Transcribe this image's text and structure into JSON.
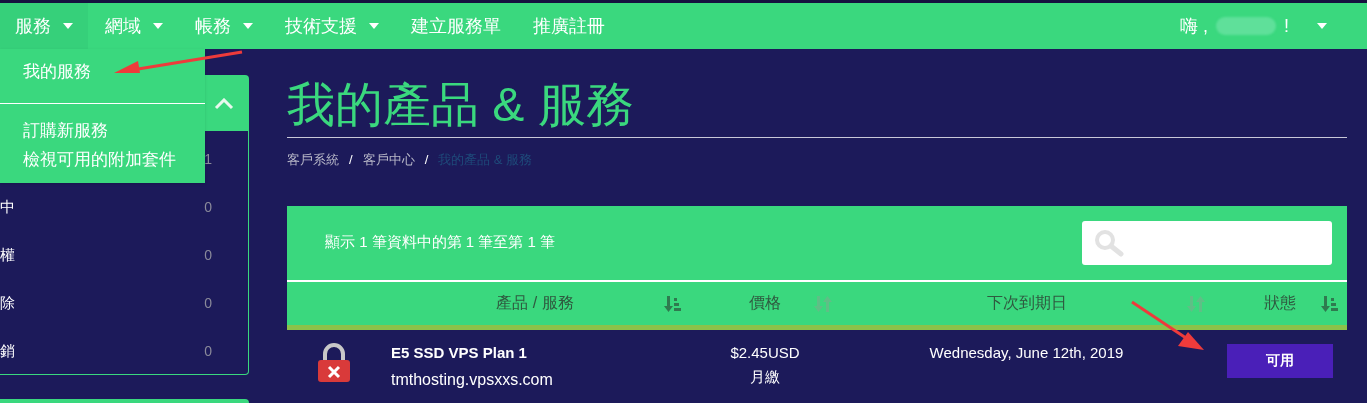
{
  "nav": {
    "items": [
      {
        "label": "服務",
        "has_menu": true,
        "open": true
      },
      {
        "label": "網域",
        "has_menu": true,
        "open": false
      },
      {
        "label": "帳務",
        "has_menu": true,
        "open": false
      },
      {
        "label": "技術支援",
        "has_menu": true,
        "open": false
      },
      {
        "label": "建立服務單",
        "has_menu": false,
        "open": false
      },
      {
        "label": "推廣註冊",
        "has_menu": false,
        "open": false
      }
    ],
    "menu_groups": [
      [
        "我的服務"
      ],
      [
        "訂購新服務",
        "檢視可用的附加套件"
      ]
    ],
    "greeting": {
      "prefix": "嗨 ,",
      "suffix": "!"
    }
  },
  "sidebar": {
    "expanded": true,
    "items": [
      {
        "count": "1"
      },
      {
        "label": "中",
        "count": "0"
      },
      {
        "label": "權",
        "count": "0"
      },
      {
        "label": "除",
        "count": "0"
      },
      {
        "label": "銷",
        "count": "0"
      }
    ]
  },
  "page": {
    "title": "我的產品 & 服務",
    "separator": "/",
    "breadcrumb": [
      {
        "label": "客戶系統",
        "current": false
      },
      {
        "label": "客戶中心",
        "current": false
      },
      {
        "label": "我的產品 & 服務",
        "current": true
      }
    ]
  },
  "table": {
    "info": "顯示 1 筆資料中的第 1 筆至第 1 筆",
    "columns": [
      {
        "label": "產品 / 服務",
        "sorted": true
      },
      {
        "label": "價格",
        "sorted": false
      },
      {
        "label": "下次到期日",
        "sorted": false
      },
      {
        "label": "狀態",
        "sorted": true
      }
    ],
    "rows": [
      {
        "locked": true,
        "name": "E5 SSD VPS Plan 1",
        "domain": "tmthosting.vpsxxs.com",
        "price": "$2.45USD",
        "cycle": "月繳",
        "due": "Wednesday, June 12th, 2019",
        "status": "可用",
        "color": "#4a1fb8"
      }
    ]
  }
}
